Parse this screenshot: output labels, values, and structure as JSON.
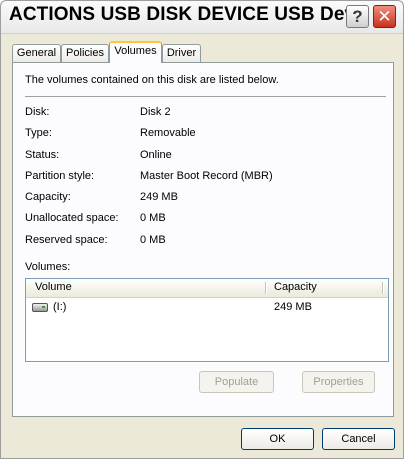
{
  "window": {
    "title": "ACTIONS USB DISK DEVICE USB Dev...",
    "help_glyph": "?",
    "close_glyph": "✕"
  },
  "tabs": [
    {
      "label": "General",
      "active": false
    },
    {
      "label": "Policies",
      "active": false
    },
    {
      "label": "Volumes",
      "active": true
    },
    {
      "label": "Driver",
      "active": false
    }
  ],
  "volumes_page": {
    "description": "The volumes contained on this disk are listed below.",
    "properties": [
      {
        "label": "Disk:",
        "value": "Disk 2"
      },
      {
        "label": "Type:",
        "value": "Removable"
      },
      {
        "label": "Status:",
        "value": "Online"
      },
      {
        "label": "Partition style:",
        "value": "Master Boot Record (MBR)"
      },
      {
        "label": "Capacity:",
        "value": "249 MB"
      },
      {
        "label": "Unallocated space:",
        "value": "0 MB"
      },
      {
        "label": "Reserved space:",
        "value": "0 MB"
      }
    ],
    "volumes_label": "Volumes:",
    "columns": {
      "volume": "Volume",
      "capacity": "Capacity"
    },
    "rows": [
      {
        "volume": "(I:)",
        "capacity": "249 MB",
        "icon": "removable-drive-icon"
      }
    ],
    "populate_label": "Populate",
    "properties_label": "Properties"
  },
  "footer": {
    "ok_label": "OK",
    "cancel_label": "Cancel"
  },
  "colors": {
    "dialog_bg": "#ece9d8",
    "panel_bg": "#fcfcfe",
    "active_tab_accent": "#ffc83c",
    "close_button": "#c7321c"
  }
}
